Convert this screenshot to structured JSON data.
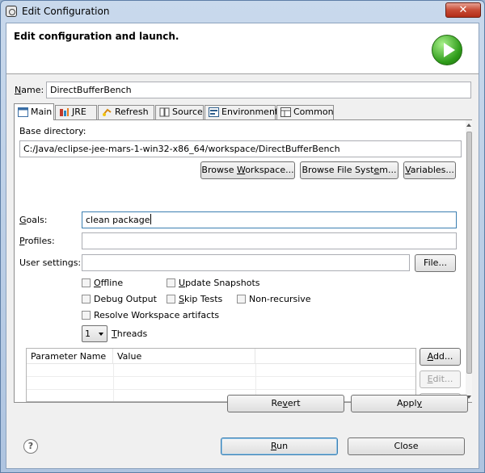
{
  "window": {
    "title": "Edit Configuration",
    "close_label": "✕"
  },
  "banner": {
    "title": "Edit configuration and launch."
  },
  "name": {
    "label_pre": "",
    "label_u": "N",
    "label_post": "ame:",
    "value": "DirectBufferBench"
  },
  "tabs": [
    {
      "label": "Main"
    },
    {
      "label": "JRE"
    },
    {
      "label": "Refresh"
    },
    {
      "label": "Source"
    },
    {
      "label": "Environment"
    },
    {
      "label": "Common"
    }
  ],
  "main": {
    "base_dir_label": "Base directory:",
    "base_dir_value": "C:/Java/eclipse-jee-mars-1-win32-x86_64/workspace/DirectBufferBench",
    "browse_workspace": {
      "pre": "Browse ",
      "u": "W",
      "post": "orkspace..."
    },
    "browse_fs": {
      "pre": "Browse File Syst",
      "u": "e",
      "post": "m..."
    },
    "variables": {
      "pre": "",
      "u": "V",
      "post": "ariables..."
    },
    "goals": {
      "label_pre": "",
      "label_u": "G",
      "label_post": "oals:",
      "value": "clean package"
    },
    "profiles": {
      "label_pre": "",
      "label_u": "P",
      "label_post": "rofiles:",
      "value": ""
    },
    "user_settings": {
      "label": "User settings:",
      "value": ""
    },
    "file_button": "File...",
    "options": {
      "offline": {
        "pre": "",
        "u": "O",
        "post": "ffline"
      },
      "update_snapshots": {
        "pre": "",
        "u": "U",
        "post": "pdate Snapshots"
      },
      "debug_output": "Debug Output",
      "skip_tests": {
        "pre": "",
        "u": "S",
        "post": "kip Tests"
      },
      "non_recursive": "Non-recursive",
      "resolve_ws": "Resolve Workspace artifacts"
    },
    "threads": {
      "value": "1",
      "label_pre": "",
      "label_u": "T",
      "label_post": "hreads"
    },
    "params_table": {
      "columns": [
        "Parameter Name",
        "Value"
      ]
    },
    "add_button": {
      "pre": "",
      "u": "A",
      "post": "dd..."
    },
    "edit_button": {
      "pre": "",
      "u": "E",
      "post": "dit..."
    }
  },
  "revert_button": {
    "pre": "Re",
    "u": "v",
    "post": "ert"
  },
  "apply_button": {
    "pre": "Appl",
    "u": "y",
    "post": ""
  },
  "run_button": {
    "pre": "",
    "u": "R",
    "post": "un"
  },
  "close_button": "Close"
}
